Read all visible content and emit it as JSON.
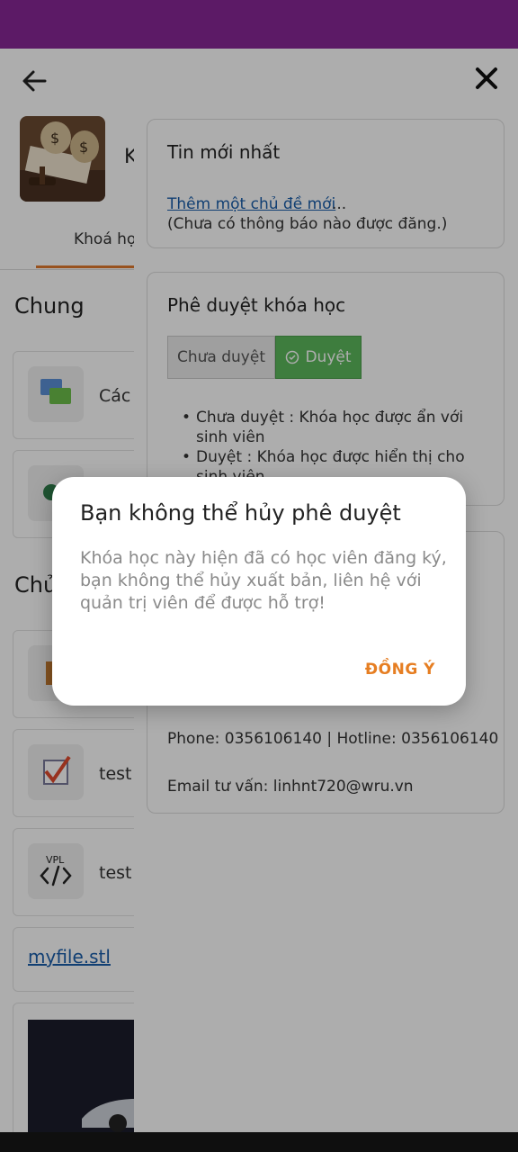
{
  "page": {
    "course_initial": "K",
    "tab_label": "Khoá học",
    "sections": {
      "general": "Chung",
      "topics_partial": "Chủ"
    },
    "cards": [
      {
        "text": "Các"
      },
      {
        "text": ""
      },
      {
        "text": ""
      },
      {
        "text": "test"
      },
      {
        "text": "test"
      }
    ],
    "vpl_label": "VPL",
    "file_link": "myfile.stl"
  },
  "drawer": {
    "news": {
      "title": "Tin mới nhất",
      "add_topic_link": "Thêm một chủ đề mới",
      "dots": "...",
      "empty": "(Chưa có thông báo nào được đăng.)"
    },
    "approval": {
      "title": "Phê duyệt khóa học",
      "not_approved_btn": "Chưa duyệt",
      "approved_btn": "Duyệt",
      "bullets": [
        "Chưa duyệt : Khóa học được ẩn với sinh viên",
        "Duyệt : Khóa học được hiển thị cho sinh viên"
      ]
    },
    "contact": {
      "phone": "Phone: 0356106140 | Hotline: 0356106140",
      "email": "Email tư vấn: linhnt720@wru.vn"
    }
  },
  "dialog": {
    "title": "Bạn không thể hủy phê duyệt",
    "message": "Khóa học này hiện đã có học viên đăng ký, bạn không thể hủy xuất bản, liên hệ với quản trị viên để được hỗ trợ!",
    "confirm": "ĐỒNG Ý"
  },
  "colors": {
    "status_bar": "#5c1a66",
    "accent": "#e07a2e",
    "approved_green": "#5cb85c",
    "link": "#1a5eaa"
  }
}
